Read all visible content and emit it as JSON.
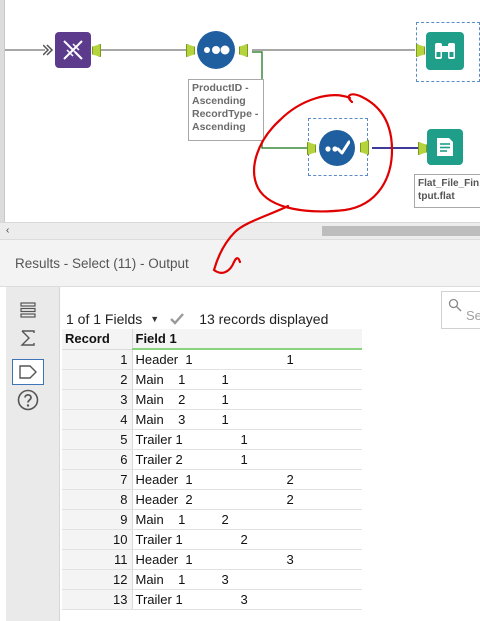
{
  "canvas": {
    "annotation_text": "ProductID -\nAscending\nRecordType -\nAscending",
    "output_filename": "Flat_File_Fin\ntput.flat"
  },
  "results": {
    "title": "Results - Select (11) - Output",
    "fields_label": "1 of 1 Fields",
    "records_label": "13 records displayed",
    "search_placeholder": "Se",
    "columns": [
      "Record",
      "Field 1"
    ],
    "rows": [
      {
        "record": "1",
        "field": "Header  1                          1"
      },
      {
        "record": "2",
        "field": "Main    1          1"
      },
      {
        "record": "3",
        "field": "Main    2          1"
      },
      {
        "record": "4",
        "field": "Main    3          1"
      },
      {
        "record": "5",
        "field": "Trailer 1                1"
      },
      {
        "record": "6",
        "field": "Trailer 2                1"
      },
      {
        "record": "7",
        "field": "Header  1                          2"
      },
      {
        "record": "8",
        "field": "Header  2                          2"
      },
      {
        "record": "9",
        "field": "Main    1          2"
      },
      {
        "record": "10",
        "field": "Trailer 1                2"
      },
      {
        "record": "11",
        "field": "Header  1                          3"
      },
      {
        "record": "12",
        "field": "Main    1          3"
      },
      {
        "record": "13",
        "field": "Trailer 1                3"
      }
    ]
  },
  "colors": {
    "accent_blue": "#1f5f9f",
    "tool_green": "#1f9e8a",
    "tool_purple": "#5c3b8c",
    "anchor_green": "#b5d33d",
    "red_annotation": "#e00000"
  },
  "icons": [
    "dna-icon",
    "sort-icon",
    "select-icon",
    "browse-icon",
    "output-icon",
    "list-icon",
    "sigma-icon",
    "tag-icon",
    "help-icon",
    "check-icon",
    "search-icon"
  ]
}
